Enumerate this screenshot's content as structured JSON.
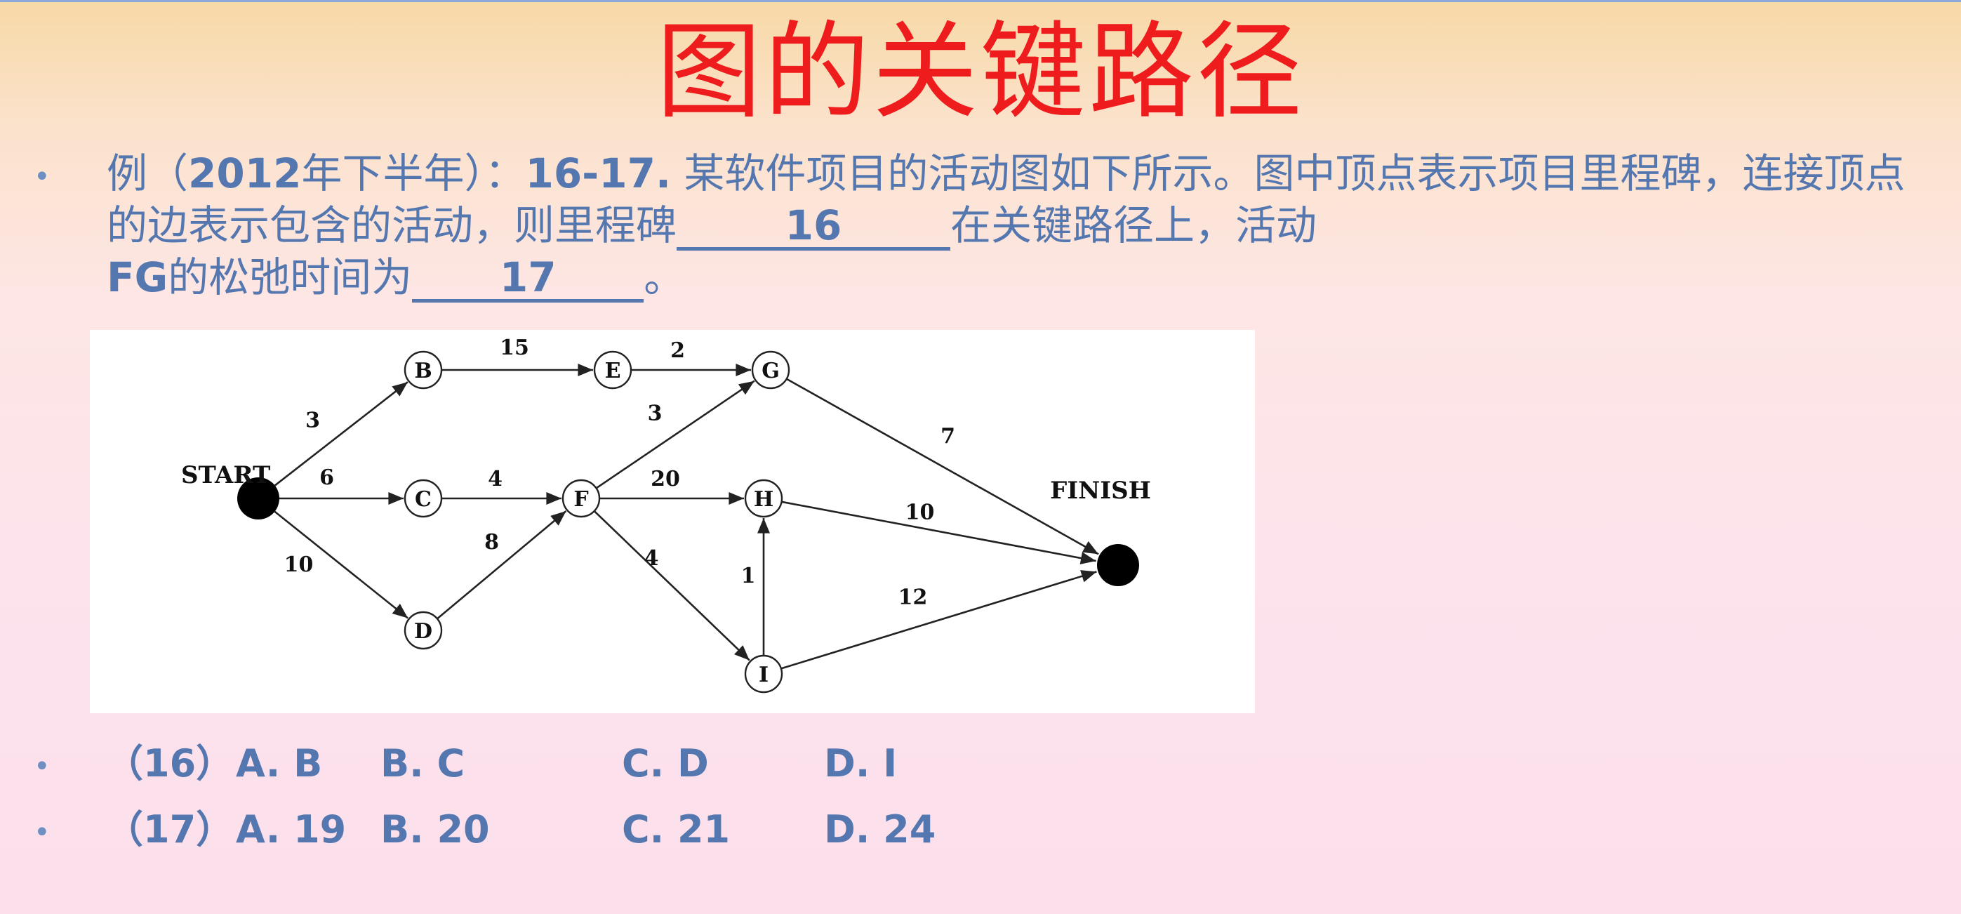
{
  "title": "图的关键路径",
  "question": {
    "prefix": "例（",
    "year": "2012",
    "mid1": "年下半年）：",
    "qnum": "16-17.",
    "text1": " 某软件项目的活动图如下所示。图中顶点表示项目里程碑，连接顶点的边表示包含的活动，则里程碑",
    "blank16": "16",
    "text2": "在关键路径上，活动",
    "fg": "FG",
    "text3": "的松弛时间为",
    "blank17": "17",
    "text4": "。"
  },
  "diagram": {
    "nodes": [
      {
        "id": "START",
        "label": "START",
        "filled": true
      },
      {
        "id": "B",
        "label": "B"
      },
      {
        "id": "C",
        "label": "C"
      },
      {
        "id": "D",
        "label": "D"
      },
      {
        "id": "E",
        "label": "E"
      },
      {
        "id": "F",
        "label": "F"
      },
      {
        "id": "G",
        "label": "G"
      },
      {
        "id": "H",
        "label": "H"
      },
      {
        "id": "I",
        "label": "I"
      },
      {
        "id": "FINISH",
        "label": "FINISH",
        "filled": true
      }
    ],
    "edges": [
      {
        "from": "START",
        "to": "B",
        "weight": "3"
      },
      {
        "from": "START",
        "to": "C",
        "weight": "6"
      },
      {
        "from": "START",
        "to": "D",
        "weight": "10"
      },
      {
        "from": "B",
        "to": "E",
        "weight": "15"
      },
      {
        "from": "C",
        "to": "F",
        "weight": "4"
      },
      {
        "from": "D",
        "to": "F",
        "weight": "8"
      },
      {
        "from": "E",
        "to": "G",
        "weight": "2"
      },
      {
        "from": "F",
        "to": "G",
        "weight": "3"
      },
      {
        "from": "F",
        "to": "H",
        "weight": "20"
      },
      {
        "from": "F",
        "to": "I",
        "weight": "4"
      },
      {
        "from": "I",
        "to": "H",
        "weight": "1"
      },
      {
        "from": "G",
        "to": "FINISH",
        "weight": "7"
      },
      {
        "from": "H",
        "to": "FINISH",
        "weight": "10"
      },
      {
        "from": "I",
        "to": "FINISH",
        "weight": "12"
      }
    ]
  },
  "options": [
    {
      "num": "（16）",
      "a": "A. B",
      "b": "B. C",
      "c": "C. D",
      "d": "D. I"
    },
    {
      "num": "（17）",
      "a": "A. 19",
      "b": "B. 20",
      "c": "C. 21",
      "d": "D. 24"
    }
  ]
}
